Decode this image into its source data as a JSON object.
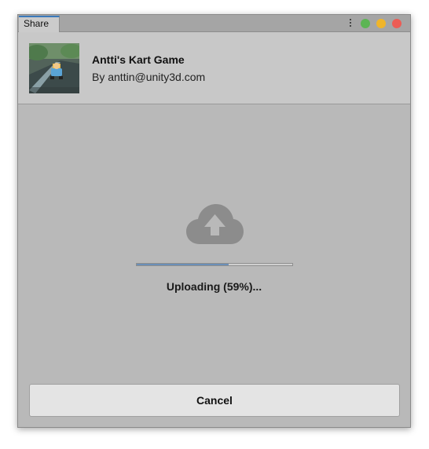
{
  "window": {
    "tab_label": "Share"
  },
  "traffic_lights": {
    "green": "#5cb554",
    "yellow": "#f0b52a",
    "red": "#ec5c55"
  },
  "header": {
    "thumbnail": "kart-game-thumbnail",
    "game_title": "Antti's Kart Game",
    "author": "By anttin@unity3d.com"
  },
  "upload": {
    "icon": "cloud-upload-icon",
    "progress": 0.59,
    "status_text": "Uploading (59%)..."
  },
  "footer": {
    "cancel_label": "Cancel"
  },
  "colors": {
    "accent": "#3a79bb",
    "progress_fill": "#6a8fb8",
    "icon_gray": "#8c8c8c"
  }
}
